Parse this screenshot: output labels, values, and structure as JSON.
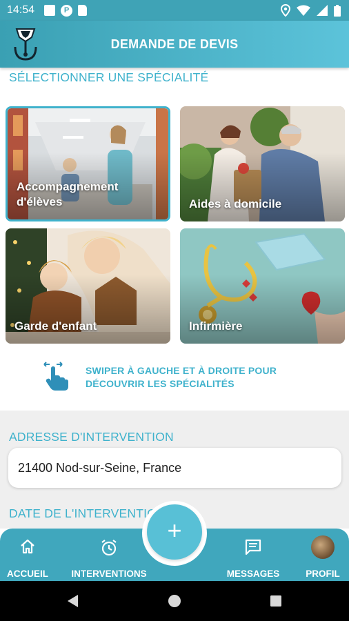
{
  "status_bar": {
    "time": "14:54"
  },
  "app_bar": {
    "title": "DEMANDE DE DEVIS"
  },
  "speciality": {
    "section_title": "SÉLECTIONNER UNE SPÉCIALITÉ",
    "cards": [
      {
        "label": "Accompagnement d'élèves",
        "selected": true
      },
      {
        "label": "Aides à domicile",
        "selected": false
      },
      {
        "label": "Garde d'enfant",
        "selected": false
      },
      {
        "label": "Infirmière",
        "selected": false
      }
    ],
    "hint": "SWIPER À GAUCHE ET À DROITE POUR DÉCOUVRIR LES SPÉCIALITÉS"
  },
  "address": {
    "section_title": "ADRESSE D'INTERVENTION",
    "value": "21400 Nod-sur-Seine, France"
  },
  "date": {
    "section_title": "DATE DE L'INTERVENTION"
  },
  "fab": {
    "icon": "plus-icon"
  },
  "bottom_nav": {
    "items": [
      {
        "label": "ACCUEIL",
        "icon": "home-icon"
      },
      {
        "label": "INTERVENTIONS",
        "icon": "alarm-clock-icon"
      },
      {
        "label": "MESSAGES",
        "icon": "message-icon"
      },
      {
        "label": "PROFIL",
        "icon": "avatar"
      }
    ]
  },
  "colors": {
    "accent": "#3fb2cc",
    "app_bar": "#3fa3b6",
    "bottom_nav": "#40a7bd"
  }
}
